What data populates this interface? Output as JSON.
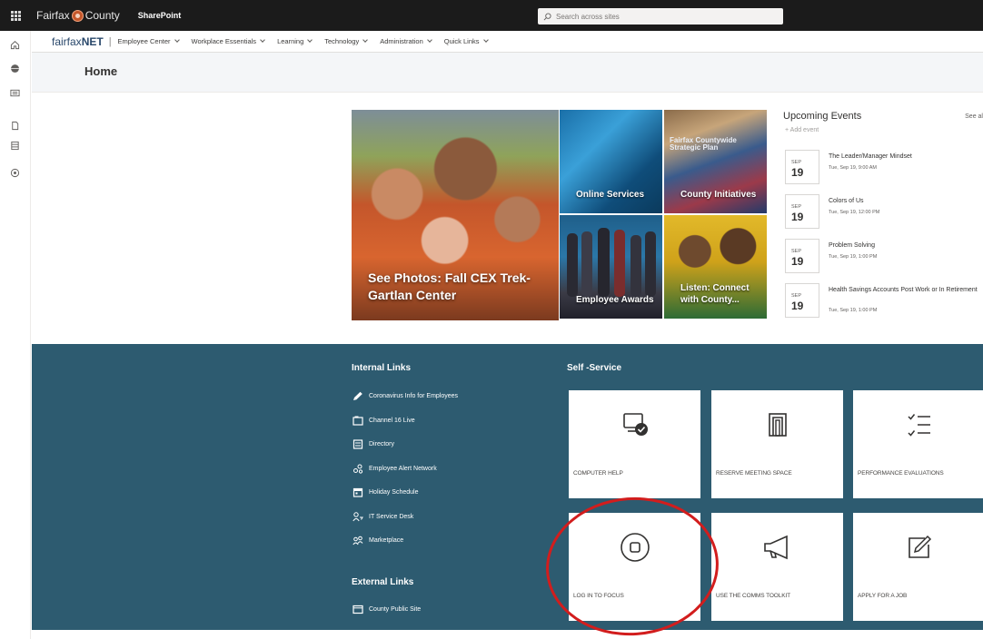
{
  "suite_bar": {
    "org_name_left": "Fairfax",
    "org_name_right": "County",
    "app_name": "SharePoint",
    "search_placeholder": "Search across sites"
  },
  "hub_nav": {
    "site_title_prefix": "fairfax",
    "site_title_bold": "NET",
    "separator": "|",
    "items": [
      "Employee Center",
      "Workplace Essentials",
      "Learning",
      "Technology",
      "Administration",
      "Quick Links"
    ]
  },
  "page": {
    "title": "Home"
  },
  "hero": {
    "main_caption": "See Photos: Fall CEX Trek-Gartlan Center",
    "tiles": [
      {
        "caption": "Online Services"
      },
      {
        "caption": "County Initiatives",
        "overlay_text": "Fairfax Countywide Strategic Plan"
      },
      {
        "caption": "Employee Awards"
      },
      {
        "caption": "Listen: Connect with County..."
      }
    ]
  },
  "events": {
    "title": "Upcoming Events",
    "see_all": "See al",
    "add_event": "+ Add event",
    "items": [
      {
        "month": "SEP",
        "day": "19",
        "name": "The Leader/Manager Mindset",
        "time": "Tue, Sep 19, 9:00 AM"
      },
      {
        "month": "SEP",
        "day": "19",
        "name": "Colors of Us",
        "time": "Tue, Sep 19, 12:00 PM"
      },
      {
        "month": "SEP",
        "day": "19",
        "name": "Problem Solving",
        "time": "Tue, Sep 19, 1:00 PM"
      },
      {
        "month": "SEP",
        "day": "19",
        "name": "Health Savings Accounts Post Work or In Retirement",
        "time": "Tue, Sep 19, 1:00 PM"
      }
    ]
  },
  "internal_links": {
    "heading": "Internal Links",
    "items": [
      {
        "label": "Coronavirus Info for Employees",
        "icon": "pencil-icon"
      },
      {
        "label": "Channel 16 Live",
        "icon": "tv-icon"
      },
      {
        "label": "Directory",
        "icon": "directory-icon"
      },
      {
        "label": "Employee Alert Network",
        "icon": "people-network-icon"
      },
      {
        "label": "Holiday Schedule",
        "icon": "calendar-icon"
      },
      {
        "label": "IT Service Desk",
        "icon": "person-help-icon"
      },
      {
        "label": "Marketplace",
        "icon": "people-icon"
      }
    ]
  },
  "external_links": {
    "heading": "External Links",
    "items": [
      {
        "label": "County Public Site",
        "icon": "browser-icon"
      }
    ]
  },
  "self_service": {
    "heading": "Self -Service",
    "tiles": [
      {
        "label": "COMPUTER HELP",
        "icon": "computer-check-icon"
      },
      {
        "label": "RESERVE MEETING SPACE",
        "icon": "meeting-room-icon"
      },
      {
        "label": "PERFORMANCE EVALUATIONS",
        "icon": "checklist-icon"
      },
      {
        "label": "LOG IN TO FOCUS",
        "icon": "focus-circle-icon"
      },
      {
        "label": "USE THE COMMS TOOLKIT",
        "icon": "megaphone-icon"
      },
      {
        "label": "APPLY FOR A JOB",
        "icon": "edit-window-icon"
      }
    ]
  },
  "annotation": {
    "color": "#d21d1d",
    "target": "LOG IN TO FOCUS"
  },
  "colors": {
    "suite_bar": "#1b1b1b",
    "section_bg": "#2d5b70",
    "hub_title": "#29486b"
  }
}
